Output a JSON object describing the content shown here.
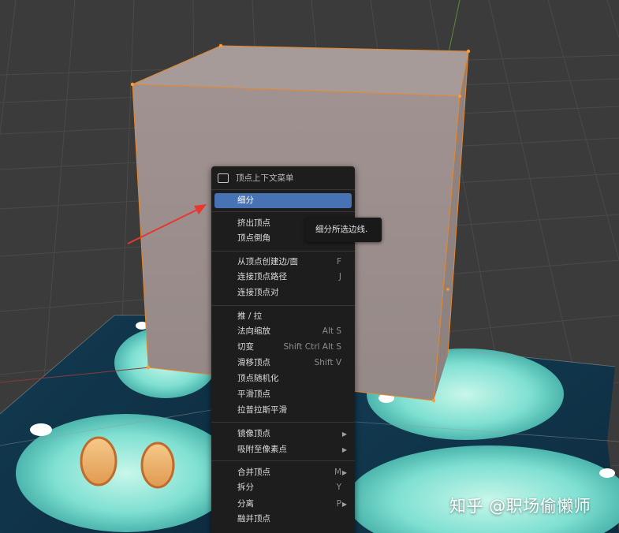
{
  "colors": {
    "viewport_bg": "#3d3d3d",
    "grid": "#4a4a4a",
    "cube_face": "#9a8d8b",
    "selection_edge": "#e8872a",
    "menu_bg": "#1d1d1d",
    "menu_highlight": "#4772b3",
    "arrow": "#e8372e",
    "axis_x": "#8a3a3a",
    "axis_y": "#5d8a3a"
  },
  "context_menu": {
    "header_icon": "vertex-menu-icon",
    "title": "顶点上下文菜单",
    "items": [
      {
        "label": "细分",
        "shortcut": "",
        "submenu": false,
        "active": true
      },
      {
        "label": "挤出顶点",
        "shortcut": "",
        "submenu": false
      },
      {
        "label": "顶点倒角",
        "shortcut": "S",
        "submenu": false
      },
      {
        "label": "从顶点创建边/面",
        "shortcut": "F",
        "submenu": false
      },
      {
        "label": "连接顶点路径",
        "shortcut": "J",
        "submenu": false
      },
      {
        "label": "连接顶点对",
        "shortcut": "",
        "submenu": false
      },
      {
        "label": "推 / 拉",
        "shortcut": "",
        "submenu": false
      },
      {
        "label": "法向缩放",
        "shortcut": "Alt S",
        "submenu": false
      },
      {
        "label": "切变",
        "shortcut": "Shift Ctrl Alt S",
        "submenu": false
      },
      {
        "label": "滑移顶点",
        "shortcut": "Shift V",
        "submenu": false
      },
      {
        "label": "顶点随机化",
        "shortcut": "",
        "submenu": false
      },
      {
        "label": "平滑顶点",
        "shortcut": "",
        "submenu": false
      },
      {
        "label": "拉普拉斯平滑",
        "shortcut": "",
        "submenu": false
      },
      {
        "label": "镜像顶点",
        "shortcut": "",
        "submenu": true
      },
      {
        "label": "吸附至像素点",
        "shortcut": "",
        "submenu": true
      },
      {
        "label": "合并顶点",
        "shortcut": "M",
        "submenu": true
      },
      {
        "label": "拆分",
        "shortcut": "Y",
        "submenu": false
      },
      {
        "label": "分离",
        "shortcut": "P",
        "submenu": true
      },
      {
        "label": "融并顶点",
        "shortcut": "",
        "submenu": false
      }
    ]
  },
  "tooltip": {
    "text": "细分所选边线."
  },
  "watermark": {
    "text": "知乎 @职场偷懒师"
  }
}
